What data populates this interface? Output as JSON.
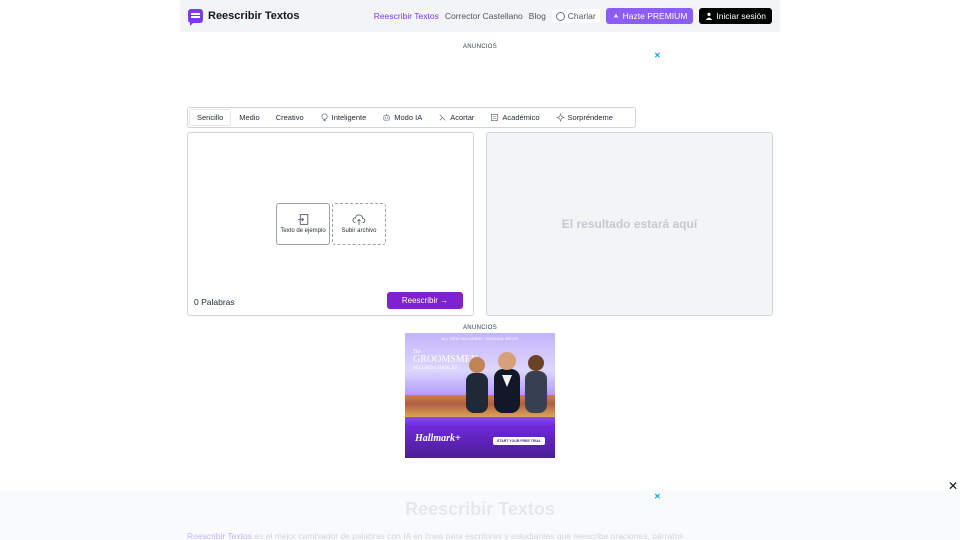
{
  "header": {
    "logo_text": "Reescribir Textos",
    "nav": {
      "rewrite": "Reescribir Textos",
      "corrector": "Corrector Castellano",
      "blog": "Blog",
      "chat": "Charlar",
      "premium": "Hazte PREMIUM",
      "login": "Iniciar sesión"
    }
  },
  "ads": {
    "label_top": "ANUNCIOS",
    "label_mid": "ANUNCIOS",
    "close_symbol": "✕",
    "banner": {
      "kicker": "ALL NEW HALLMARK+ ORIGINAL MOVIE",
      "title_small": "The",
      "title": "GROOMSMEN",
      "subtitle": "SECOND CHANCES",
      "brand": "Hallmark+",
      "cta": "START YOUR FREE TRIAL"
    }
  },
  "modes": [
    {
      "label": "Sencillo",
      "icon": "",
      "selected": true
    },
    {
      "label": "Medio",
      "icon": ""
    },
    {
      "label": "Creativo",
      "icon": ""
    },
    {
      "label": "Inteligente",
      "icon": "bulb-icon"
    },
    {
      "label": "Modo IA",
      "icon": "robot-icon"
    },
    {
      "label": "Acortar",
      "icon": "shorten-icon"
    },
    {
      "label": "Académico",
      "icon": "book-icon"
    },
    {
      "label": "Sorpréndeme",
      "icon": "sparkle-icon"
    }
  ],
  "editor": {
    "sample_text_label": "Texto de ejemplo",
    "upload_label": "Subir archivo",
    "word_count": "0 Palabras",
    "rewrite_button": "Reescribir →"
  },
  "output": {
    "placeholder": "El resultado estará aquí"
  },
  "page_close": "✕",
  "section": {
    "title": "Reescribir Textos",
    "intro_link": "Reescribir Textos",
    "intro_rest": " es el mejor cambiador de palabras con IA en línea para escritores y estudiantes que reescribe oraciones, párrafos"
  }
}
